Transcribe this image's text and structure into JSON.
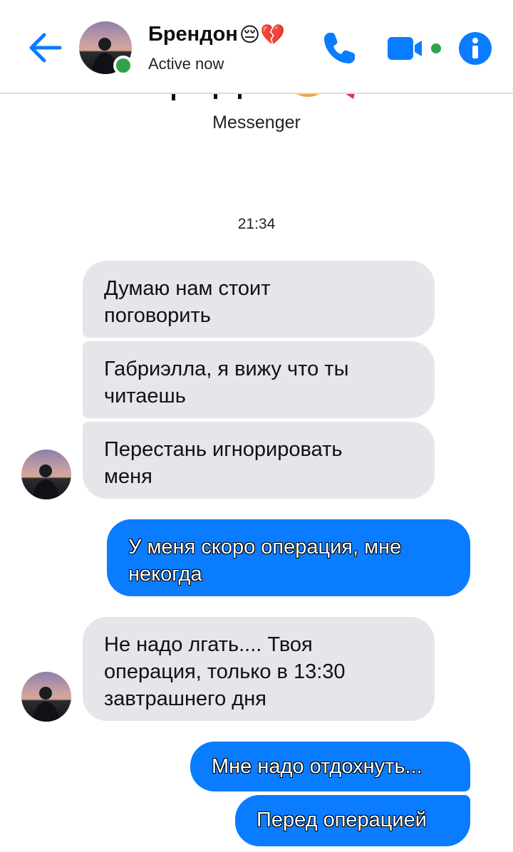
{
  "header": {
    "contact_name": "Брендон",
    "name_emojis": "😔💔",
    "status": "Active now"
  },
  "conversation": {
    "service_label": "Messenger",
    "timestamp": "21:34"
  },
  "messages": [
    {
      "direction": "incoming",
      "lines": [
        "Думаю нам стоит",
        "поговорить"
      ]
    },
    {
      "direction": "incoming",
      "lines": [
        "Габриэлла, я вижу что ты",
        "читаешь"
      ]
    },
    {
      "direction": "incoming",
      "lines": [
        "Перестань игнорировать",
        "меня"
      ]
    },
    {
      "direction": "outgoing",
      "lines": [
        "У меня скоро операция, мне",
        "некогда"
      ]
    },
    {
      "direction": "incoming",
      "lines": [
        "Не надо лгать.... Твоя",
        "операция, только в 13:30",
        "завтрашнего дня"
      ]
    },
    {
      "direction": "outgoing",
      "lines": [
        "Мне надо отдохнуть..."
      ]
    },
    {
      "direction": "outgoing",
      "lines": [
        "Перед операцией"
      ]
    }
  ],
  "colors": {
    "accent": "#0a7cff",
    "incoming_bubble": "#e5e5ea",
    "online": "#31a24c"
  },
  "icons": {
    "back": "arrow-left-icon",
    "call": "phone-icon",
    "video": "video-camera-icon",
    "info": "info-icon"
  }
}
